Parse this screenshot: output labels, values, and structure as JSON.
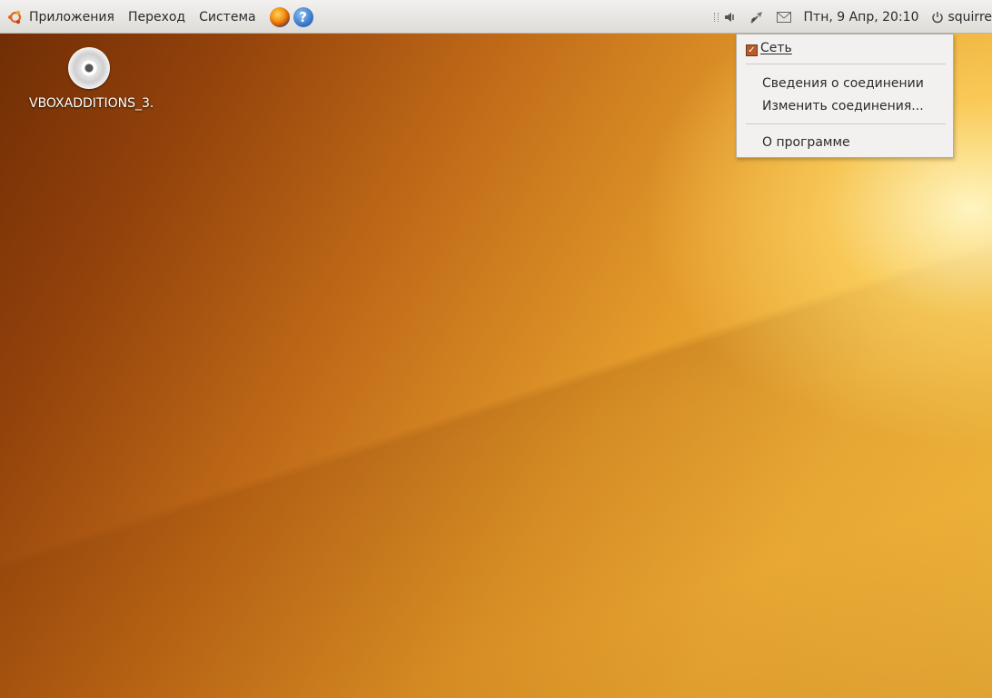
{
  "panel": {
    "menus": [
      "Приложения",
      "Переход",
      "Система"
    ],
    "launchers": [
      "firefox-icon",
      "help-icon"
    ],
    "tray": {
      "icons": [
        "volume-icon",
        "network-icon",
        "mail-icon"
      ],
      "datetime": "Птн,  9 Апр, 20:10",
      "user": "squirre"
    }
  },
  "desktop": {
    "icon_label": "VBOXADDITIONS_3."
  },
  "network_menu": {
    "items": [
      {
        "label": "Сеть",
        "checked": true
      },
      {
        "label": "Сведения о соединении"
      },
      {
        "label": "Изменить соединения..."
      },
      {
        "label": "О программе"
      }
    ]
  },
  "colors": {
    "panel": "#e8e6e2",
    "menu_bg": "#f2f1f0",
    "checkbox": "#b85a2a",
    "wallpaper_dark": "#6e2c05",
    "wallpaper_light": "#f8c243"
  }
}
